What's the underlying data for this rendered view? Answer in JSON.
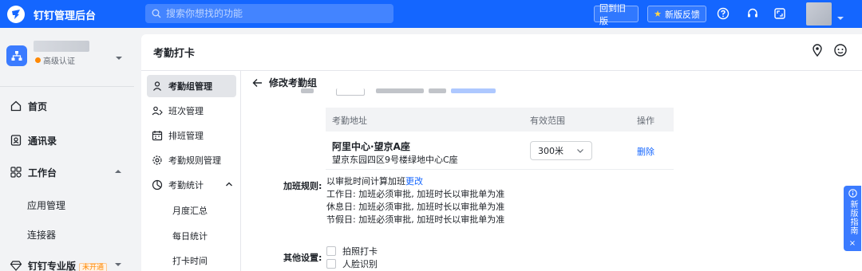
{
  "topbar": {
    "app_title": "钉钉管理后台",
    "search_placeholder": "搜索你想找的功能",
    "back_old_label": "回到旧版",
    "feedback_label": "新版反馈",
    "accent_color": "#1466ff"
  },
  "sidebar": {
    "cert_label": "高级认证",
    "items": [
      {
        "label": "首页",
        "icon": "home-icon"
      },
      {
        "label": "通讯录",
        "icon": "contacts-icon"
      },
      {
        "label": "工作台",
        "icon": "apps-icon"
      },
      {
        "label": "应用管理"
      },
      {
        "label": "连接器"
      },
      {
        "label": "钉钉专业版",
        "badge": "未开通",
        "icon": "diamond-icon"
      }
    ]
  },
  "page": {
    "title": "考勤打卡",
    "sec_nav": [
      {
        "label": "考勤组管理",
        "icon": "group-icon",
        "active": true
      },
      {
        "label": "班次管理",
        "icon": "shift-icon"
      },
      {
        "label": "排班管理",
        "icon": "calendar-icon"
      },
      {
        "label": "考勤规则管理",
        "icon": "gear-icon"
      },
      {
        "label": "考勤统计",
        "icon": "stats-icon"
      },
      {
        "label": "月度汇总"
      },
      {
        "label": "每日统计"
      },
      {
        "label": "打卡时间"
      }
    ]
  },
  "form": {
    "back_title": "修改考勤组",
    "table": {
      "headers": [
        "考勤地址",
        "有效范围",
        "操作"
      ],
      "rows": [
        {
          "name": "阿里中心·望京A座",
          "detail": "望京东园四区9号楼绿地中心C座",
          "range": "300米",
          "action": "删除"
        }
      ]
    },
    "overtime": {
      "label": "加班规则:",
      "summary": "以审批时间计算加班",
      "change_link": "更改",
      "lines": [
        "工作日: 加班必须审批, 加班时长以审批单为准",
        "休息日: 加班必须审批, 加班时长以审批单为准",
        "节假日: 加班必须审批, 加班时长以审批单为准"
      ]
    },
    "other": {
      "label": "其他设置:",
      "options": [
        "拍照打卡",
        "人脸识别"
      ]
    }
  },
  "guide": {
    "text": "新版指南",
    "close": "×"
  }
}
